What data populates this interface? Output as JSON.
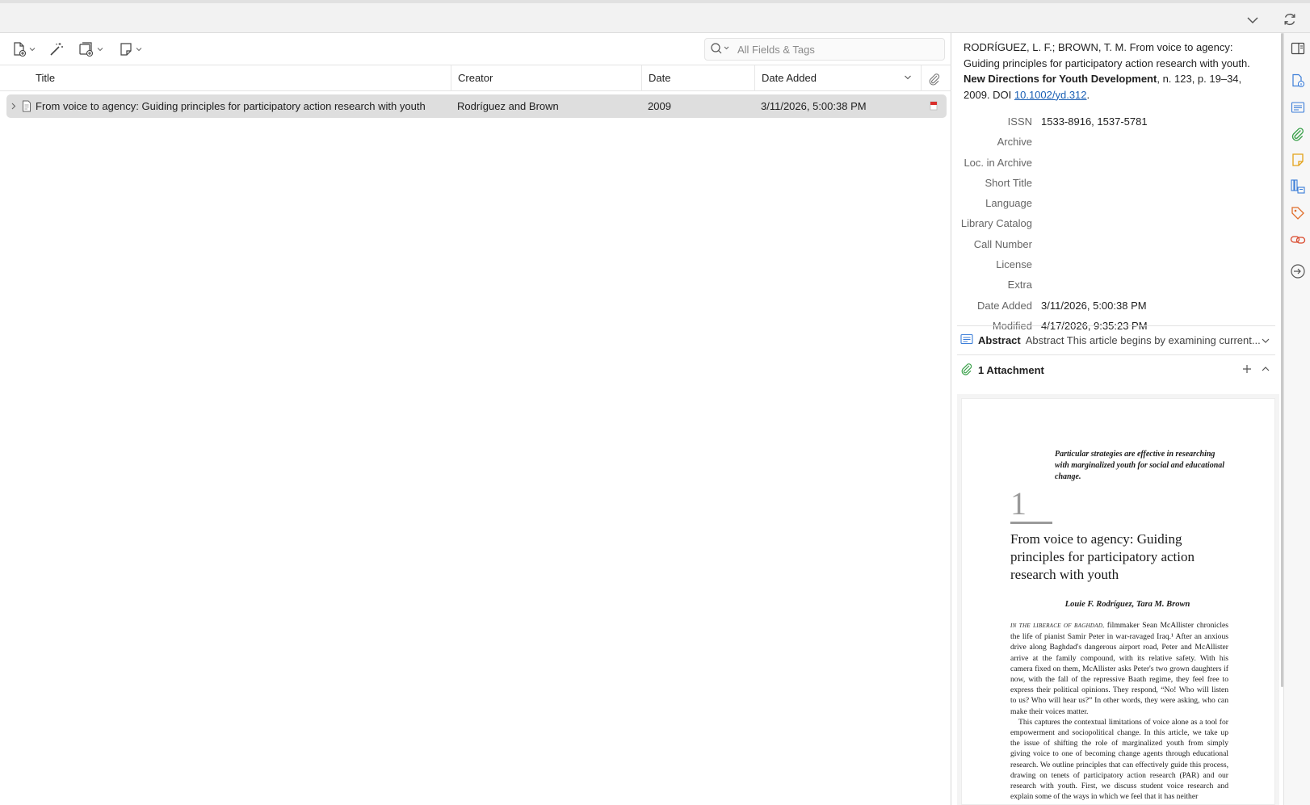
{
  "toolbar": {
    "search_placeholder": "All Fields & Tags",
    "icons": [
      "new-item-icon",
      "magic-wand-icon",
      "add-attachment-icon",
      "new-note-icon",
      "search-icon"
    ]
  },
  "columns": {
    "title": "Title",
    "creator": "Creator",
    "date": "Date",
    "date_added": "Date Added"
  },
  "items": [
    {
      "title": "From voice to agency: Guiding principles for participatory action research with youth",
      "creator": "Rodríguez and Brown",
      "date": "2009",
      "date_added": "3/11/2026, 5:00:38 PM"
    }
  ],
  "citation": {
    "authors": "RODRÍGUEZ, L. F.; BROWN, T. M. From voice to agency: Guiding principles for participatory action research with youth. ",
    "journal": "New Directions for Youth Development",
    "rest": ", n. 123, p. 19–34, 2009. DOI ",
    "doi": "10.1002/yd.312",
    "end": "."
  },
  "fields": [
    {
      "label": "ISSN",
      "value": "1533-8916, 1537-5781"
    },
    {
      "label": "Archive",
      "value": ""
    },
    {
      "label": "Loc. in Archive",
      "value": ""
    },
    {
      "label": "Short Title",
      "value": ""
    },
    {
      "label": "Language",
      "value": ""
    },
    {
      "label": "Library Catalog",
      "value": ""
    },
    {
      "label": "Call Number",
      "value": ""
    },
    {
      "label": "License",
      "value": ""
    },
    {
      "label": "Extra",
      "value": ""
    },
    {
      "label": "Date Added",
      "value": "3/11/2026, 5:00:38 PM"
    },
    {
      "label": "Modified",
      "value": "4/17/2026, 9:35:23 PM"
    }
  ],
  "abstract": {
    "label": "Abstract",
    "summary": "Abstract This article begins by examining current..."
  },
  "attachments": {
    "label": "1 Attachment"
  },
  "pdf_preview": {
    "epigraph": "Particular strategies are effective in researching with marginalized youth for social and educational change.",
    "chapter_number": "1",
    "title": "From voice to agency: Guiding principles for participatory action research with youth",
    "authors": "Louie F. Rodríguez, Tara M. Brown",
    "lead_smallcaps": "In the Liberace of Baghdad,",
    "para1": " filmmaker Sean McAllister chronicles the life of pianist Samir Peter in war-ravaged Iraq.¹ After an anxious drive along Baghdad's dangerous airport road, Peter and McAllister arrive at the family compound, with its relative safety. With his camera fixed on them, McAllister asks Peter's two grown daughters if now, with the fall of the repressive Baath regime, they feel free to express their political opinions. They respond, “No! Who will listen to us? Who will hear us?” In other words, they were asking, who can make their voices matter.",
    "para2": "This captures the contextual limitations of voice alone as a tool for empowerment and sociopolitical change. In this article, we take up the issue of shifting the role of marginalized youth from simply giving voice to one of becoming change agents through educational research. We outline principles that can effectively guide this process, drawing on tenets of participatory action research (PAR) and our research with youth. First, we discuss student voice research and explain some of the ways in which we feel that it has neither"
  },
  "colors": {
    "accent": "#1a5fb4",
    "selected_row": "#dedede",
    "pdf_badge": "#d9302c",
    "sidenav_blue": "#3b7dd8",
    "sidenav_green": "#3aa04a",
    "sidenav_yellow": "#e3a21a",
    "sidenav_orange": "#e06d2a",
    "sidenav_red": "#d9482c"
  }
}
